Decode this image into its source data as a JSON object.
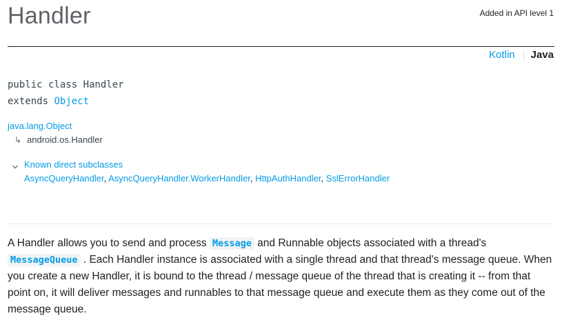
{
  "header": {
    "title": "Handler",
    "api_level": "Added in API level 1"
  },
  "lang_switch": {
    "kotlin": "Kotlin",
    "java": "Java"
  },
  "declaration": {
    "line1": "public class Handler",
    "extends_kw": "extends ",
    "parent": "Object"
  },
  "hierarchy": {
    "root": "java.lang.Object",
    "child": "android.os.Handler"
  },
  "subclasses": {
    "title": "Known direct subclasses",
    "items": [
      "AsyncQueryHandler",
      "AsyncQueryHandler.WorkerHandler",
      "HttpAuthHandler",
      "SslErrorHandler"
    ]
  },
  "description": {
    "p1_a": "A Handler allows you to send and process ",
    "code1": "Message",
    "p1_b": " and Runnable objects associated with a thread's ",
    "code2": "MessageQueue",
    "p1_c": " . Each Handler instance is associated with a single thread and that thread's message queue. When you create a new Handler, it is bound to the thread / message queue of the thread that is creating it -- from that point on, it will deliver messages and runnables to that message queue and execute them as they come out of the message queue."
  },
  "colors": {
    "link": "#039be5",
    "text": "#202124",
    "title": "#5f6368"
  }
}
